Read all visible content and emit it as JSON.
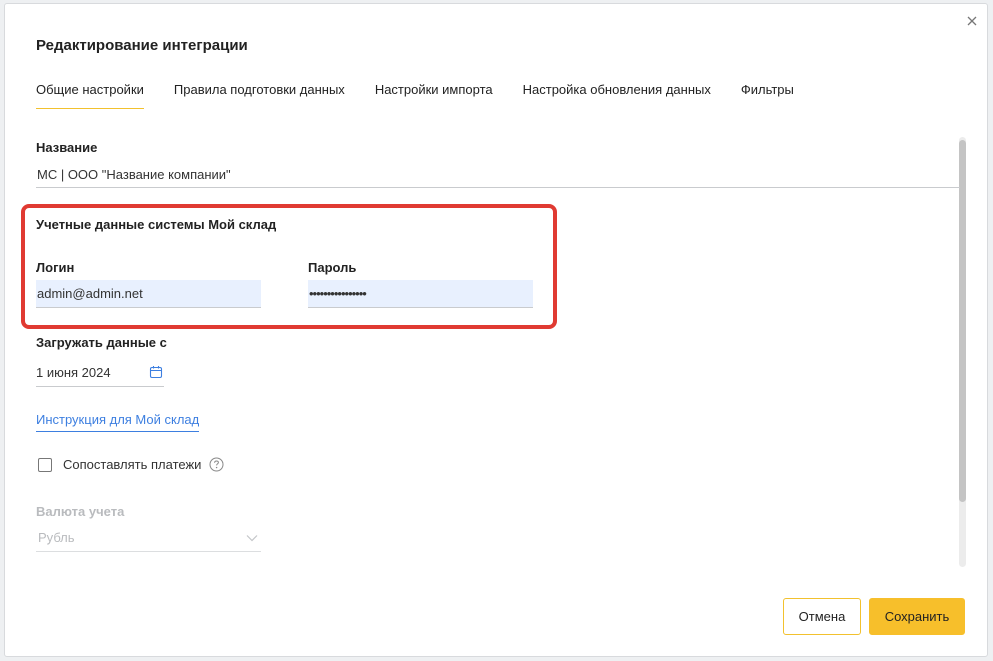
{
  "dialog": {
    "title": "Редактирование интеграции"
  },
  "tabs": [
    {
      "label": "Общие настройки",
      "active": true
    },
    {
      "label": "Правила подготовки данных",
      "active": false
    },
    {
      "label": "Настройки импорта",
      "active": false
    },
    {
      "label": "Настройка обновления данных",
      "active": false
    },
    {
      "label": "Фильтры",
      "active": false
    }
  ],
  "form": {
    "name_label": "Название",
    "name_value": "МС | ООО \"Название компании\"",
    "credentials_section": "Учетные данные системы Мой склад",
    "login_label": "Логин",
    "login_value": "admin@admin.net",
    "password_label": "Пароль",
    "password_value": "••••••••••••••••",
    "date_label": "Загружать данные с",
    "date_value": "1 июня 2024",
    "instruction_link": "Инструкция для Мой склад",
    "match_payments_label": "Сопоставлять платежи",
    "match_payments_checked": false,
    "currency_label": "Валюта учета",
    "currency_value": "Рубль"
  },
  "buttons": {
    "cancel": "Отмена",
    "save": "Сохранить"
  },
  "colors": {
    "accent": "#f7bf2b",
    "link": "#3d7fe0",
    "highlight": "#e03a32",
    "autofill": "#e8f0fe"
  },
  "icons": {
    "close": "close-icon",
    "calendar": "calendar-icon",
    "help": "help-icon",
    "chevron": "chevron-down-icon"
  }
}
